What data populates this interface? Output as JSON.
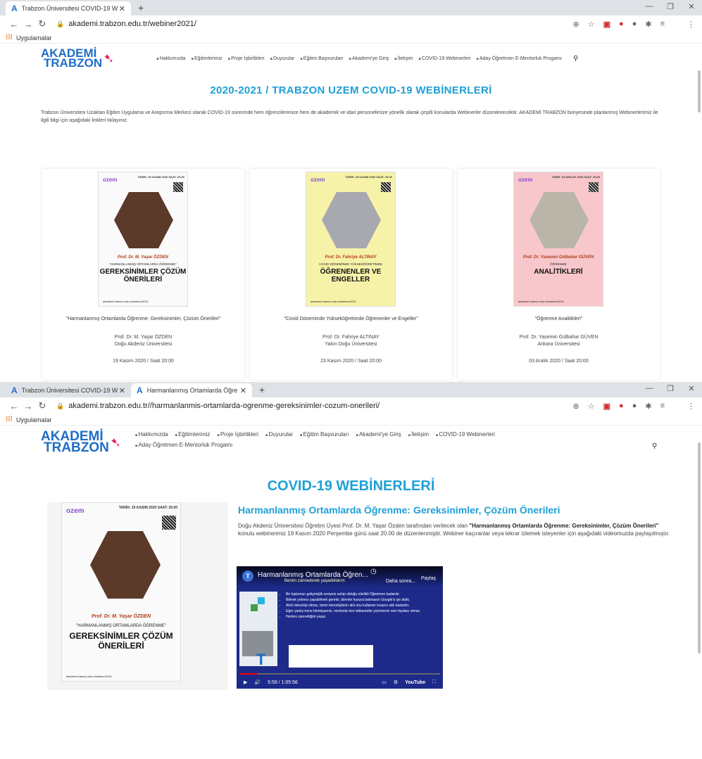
{
  "win1": {
    "tab_title": "Trabzon Üniversitesi COVID-19 W",
    "url": "akademi.trabzon.edu.tr/webiner2021/",
    "bookmark": "Uygulamalar",
    "menu": [
      "Hakkımızda",
      "Eğitimlerimiz",
      "Proje İşbirlikleri",
      "Duyurular",
      "Eğitim Başvuruları",
      "Akademi'ye Giriş",
      "İletişim",
      "COVID-19 Webinerleri",
      "Aday Öğretmen E-Mentorluk Progamı"
    ],
    "page_title": "2020-2021 / TRABZON UZEM COVID-19 WEBİNERLERİ",
    "intro": "Trabzon Üniversitesi Uzaktan Eğitim Uygulama ve Araştırma Merkezi olarak COVID-19 sürecinde hem öğrencilerimize hem de akademik ve idari personelimize yönelik olarak çeşitli konularda Webinerler düzenlenecektir. AKADEMİ TRABZON bünyesinde planlanmış Webinerlerimiz ile ilgili bilgi için aşağıdaki linkleri tıklayınız.",
    "cards": [
      {
        "title": "\"Harmanlanmış Ortamlarda Öğrenme: Gereksinimler, Çözüm Önerileri\"",
        "name": "Prof. Dr. M. Yaşar ÖZDEN",
        "uni": "Doğu Akdeniz Üniversitesi",
        "date": "19 Kasım 2020 / Saat 20:00",
        "poster_date": "TARİH: 19 KASIM 2020 SAAT: 20.00",
        "poster_name": "Prof. Dr. M. Yaşar ÖZDEN",
        "poster_sub": "\"HARMANLANMIŞ ORTAMLARDA ÖĞRENME\"",
        "poster_main": "GEREKSİNİMLER ÇÖZÜM ÖNERİLERİ"
      },
      {
        "title": "\"Covid Döneminde Yükseköğretimde Öğrenenler ve Engeller\"",
        "name": "Prof. Dr. Fahriye ALTINAY",
        "uni": "Yakın Doğu Üniversitesi",
        "date": "23 Kasım 2020 / Saat 20:00",
        "poster_date": "TARİH: 23 KASIM 2020 SAAT: 20.00",
        "poster_name": "Prof. Dr. Fahriye ALTINAY",
        "poster_sub": "COVID DÖNEMİNDE YÜKSEKÖĞRETİMDE",
        "poster_main": "ÖĞRENENLER VE ENGELLER"
      },
      {
        "title": "\"Öğrenme Analitikleri\"",
        "name": "Prof. Dr. Yasemin Gülbahar GÜVEN",
        "uni": "Ankara Üniversitesi",
        "date": "03 Aralık 2020 / Saat 20:00",
        "poster_date": "TARİH: 03 ARALIK 2020 SAAT: 20.00",
        "poster_name": "Prof. Dr. Yasemin Gülbahar GÜVEN",
        "poster_sub": "ÖĞRENME",
        "poster_main": "ANALİTİKLERİ"
      }
    ],
    "poster_logo": "ozem",
    "poster_footer": "akademi.trabzon.edu.tr/webiner2021"
  },
  "win2": {
    "tab1_title": "Trabzon Üniversitesi COVID-19 W",
    "tab2_title": "Harmanlanmış Ortamlarda Öğre",
    "url": "akademi.trabzon.edu.tr//harmanlanmis-ortamlarda-ogrenme-gereksinimler-cozum-onerileri/",
    "bookmark": "Uygulamalar",
    "menu_row1": [
      "Hakkımızda",
      "Eğitimlerimiz",
      "Proje İşbirlikleri",
      "Duyurular",
      "Eğitim Başvuruları",
      "Akademi'ye Giriş",
      "İletişim",
      "COVID-19 Webinerleri"
    ],
    "menu_row2": [
      "Aday Öğretmen E-Mentorluk Progamı"
    ],
    "page_title": "COVID-19 WEBİNERLERİ",
    "article_title": "Harmanlanmış Ortamlarda Öğrenme: Gereksinimler, Çözüm Önerileri",
    "article_body_1": "Doğu Akdeniz Üniversitesi Öğretim Üyesi Prof. Dr. M. Yaşar Özden tarafından verilecek olan ",
    "article_body_bold": "\"Harmanlanmış Ortamlarda Öğrenme: Gereksinimler, Çözüm Önerileri\"",
    "article_body_2": " konulu webinerimiz 19 Kasım 2020 Perşembe günü saat 20.00 de düzenlenmiştir. Webiner kaçıranlar veya tekrar izlemek isteyenler için aşağıdaki videomuzda paylaşılmıştır.",
    "video": {
      "avatar": "T",
      "title": "Harmanlanmış Ortamlarda Öğren...",
      "subtitle": "Benim zannederek yaşadıklarım",
      "overlay_right": "Daha sonra...",
      "share": "Paylaş",
      "bullets": [
        "Bir toplumun gelişmişlik seviyesi sahip olduğu nitelikli Öğretmen kadardır.",
        "Bilmek yetmez yapabilmek gerekir, bilenler kusura bakmasın Google'a işe aldık.",
        "Akıllı teknoloji olmaz, bizim teknolojilerin aklı onu kullanan insanın aklı kadardır.",
        "Eğer yanlış trene binmişseniz, vordorda ters istikamette yürümenin size faydası olmaz.",
        "Herkes zannettiğini yaşar."
      ],
      "time": "5:59 / 1:05:56",
      "progress": 0.09,
      "brand": "YouTube"
    }
  }
}
